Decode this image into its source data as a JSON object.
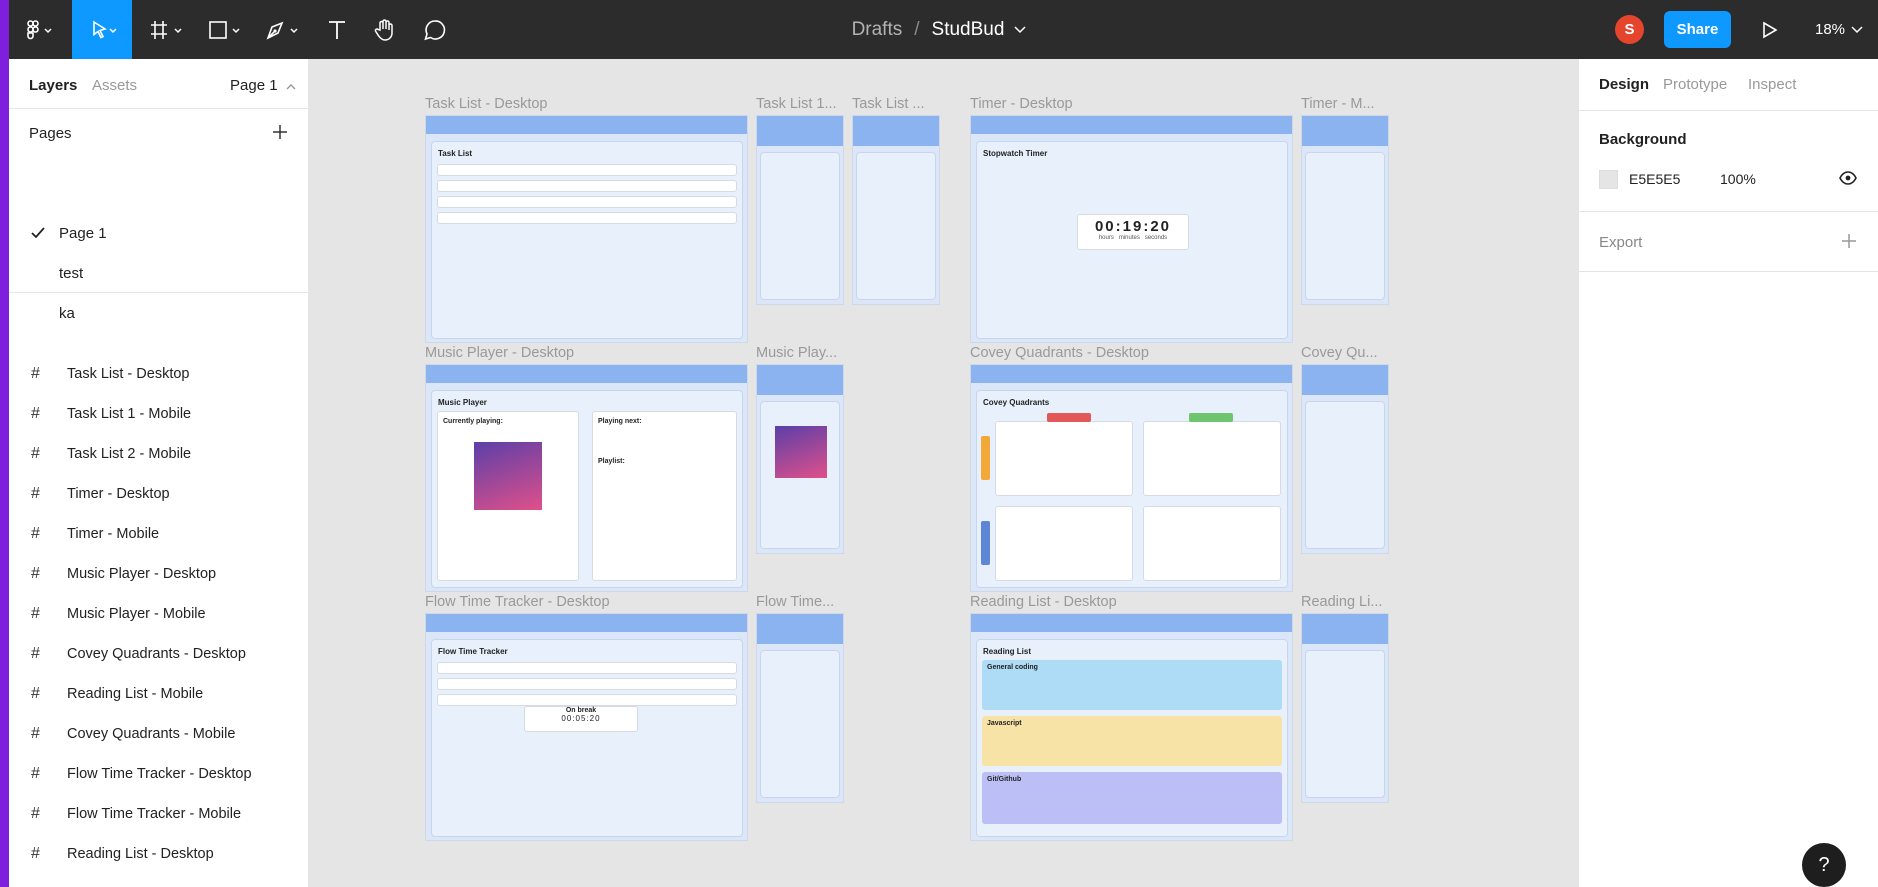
{
  "toolbar": {
    "breadcrumb_parent": "Drafts",
    "breadcrumb_separator": "/",
    "file_name": "StudBud",
    "avatar_initial": "S",
    "share_label": "Share",
    "zoom": "18%",
    "icons": [
      "figma-menu-icon",
      "move-tool-icon",
      "frame-tool-icon",
      "shape-tool-icon",
      "pen-tool-icon",
      "text-tool-icon",
      "hand-tool-icon",
      "comment-tool-icon",
      "chevron-down-icon",
      "play-icon"
    ]
  },
  "left_panel": {
    "tabs": [
      "Layers",
      "Assets"
    ],
    "page_selector": "Page 1",
    "pages_heading": "Pages",
    "pages": [
      "Page 1",
      "test",
      "ka"
    ],
    "layers": [
      "Task List - Desktop",
      "Task List 1 - Mobile",
      "Task List 2 - Mobile",
      "Timer - Desktop",
      "Timer - Mobile",
      "Music Player - Desktop",
      "Music Player - Mobile",
      "Covey Quadrants - Desktop",
      "Reading List - Mobile",
      "Covey Quadrants - Mobile",
      "Flow Time Tracker - Desktop",
      "Flow Time Tracker - Mobile",
      "Reading List - Desktop"
    ]
  },
  "canvas": {
    "frame_labels": {
      "task_desktop": "Task List - Desktop",
      "task_m1": "Task List 1...",
      "task_m2": "Task List ...",
      "timer_desktop": "Timer - Desktop",
      "timer_mobile": "Timer - M...",
      "music_desktop": "Music Player - Desktop",
      "music_mobile": "Music Play...",
      "covey_desktop": "Covey Quadrants - Desktop",
      "covey_mobile": "Covey Qu...",
      "flow_desktop": "Flow Time Tracker - Desktop",
      "flow_mobile": "Flow Time...",
      "reading_desktop": "Reading List - Desktop",
      "reading_mobile": "Reading Li..."
    },
    "frame_titles": {
      "task": "Task List",
      "timer": "Stopwatch Timer",
      "music": "Music Player",
      "covey": "Covey Quadrants",
      "flow": "Flow Time Tracker",
      "reading": "Reading List"
    },
    "brand": "StudBud",
    "timer_value": "00:19:20",
    "timer_units": "hours   minutes   seconds",
    "break_label": "On break",
    "break_value": "00:05:20",
    "music_now": "Currently playing:",
    "music_next": "Playing next:",
    "music_playlist": "Playlist:",
    "reading_sections": [
      "General coding",
      "Javascript",
      "Git/Github"
    ]
  },
  "right_panel": {
    "tabs": [
      "Design",
      "Prototype",
      "Inspect"
    ],
    "background_heading": "Background",
    "background_hex": "E5E5E5",
    "background_opacity": "100%",
    "export_heading": "Export",
    "background_color": "#e5e5e5",
    "accent": "#0d99ff"
  },
  "help_label": "?"
}
